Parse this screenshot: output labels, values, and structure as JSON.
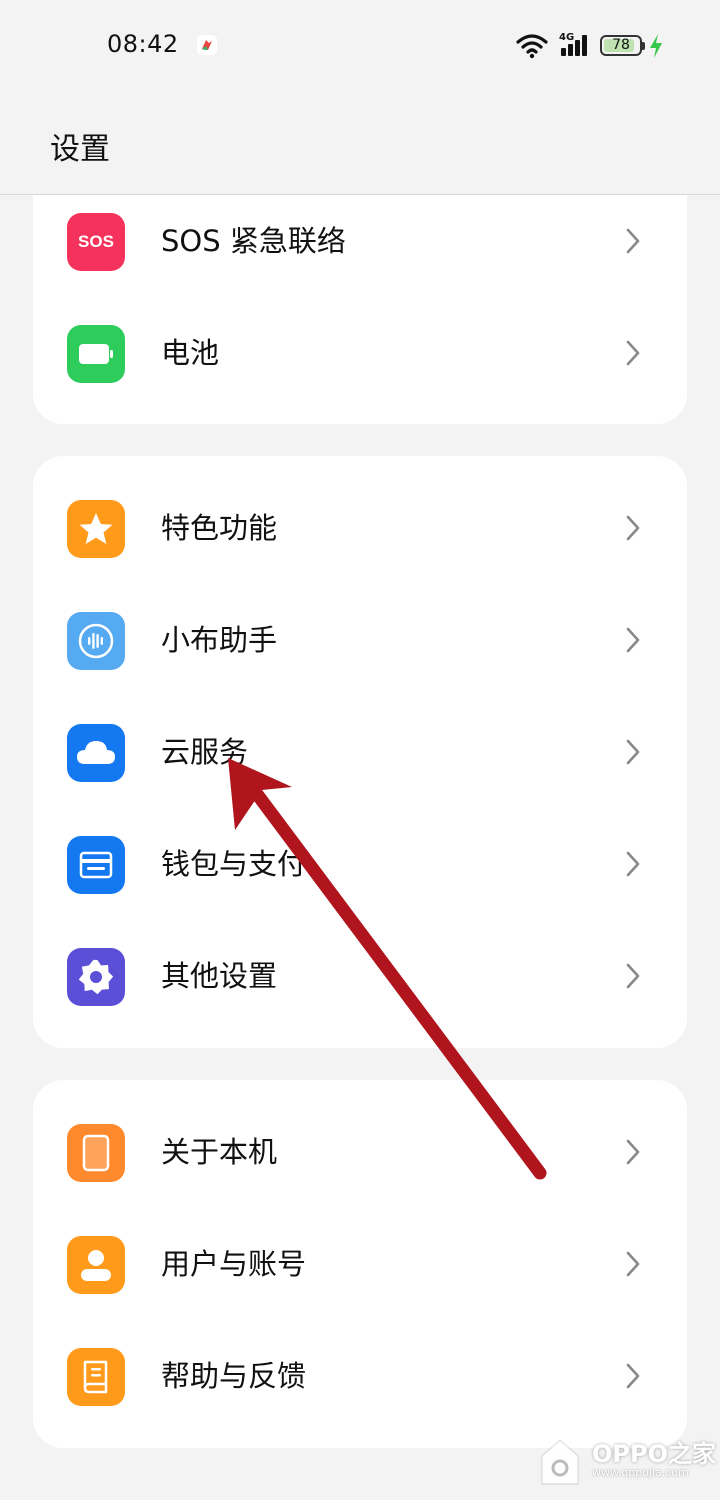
{
  "status_bar": {
    "time": "08:42",
    "network": "4G",
    "battery_percent": "78"
  },
  "header": {
    "title": "设置"
  },
  "groups": [
    {
      "items": [
        {
          "label": "SOS 紧急联络",
          "icon": "sos-icon",
          "icon_text": "SOS",
          "color": "#f5325c"
        },
        {
          "label": "电池",
          "icon": "battery-icon",
          "color": "#2ecc5b"
        }
      ]
    },
    {
      "items": [
        {
          "label": "特色功能",
          "icon": "star-icon",
          "color": "#ff9a1a"
        },
        {
          "label": "小布助手",
          "icon": "voice-assistant-icon",
          "color": "#55aaf2"
        },
        {
          "label": "云服务",
          "icon": "cloud-icon",
          "color": "#1478f0"
        },
        {
          "label": "钱包与支付",
          "icon": "wallet-icon",
          "color": "#1478f0"
        },
        {
          "label": "其他设置",
          "icon": "gear-icon",
          "color": "#5a4fd6"
        }
      ]
    },
    {
      "items": [
        {
          "label": "关于本机",
          "icon": "phone-icon",
          "color": "#ff8a2e"
        },
        {
          "label": "用户与账号",
          "icon": "user-icon",
          "color": "#ff9a1a"
        },
        {
          "label": "帮助与反馈",
          "icon": "help-book-icon",
          "color": "#ff9a1a"
        }
      ]
    }
  ],
  "watermark": {
    "text": "OPPO之家",
    "sub": "www.oppojia.com"
  },
  "annotation_arrow_color": "#b0141c"
}
